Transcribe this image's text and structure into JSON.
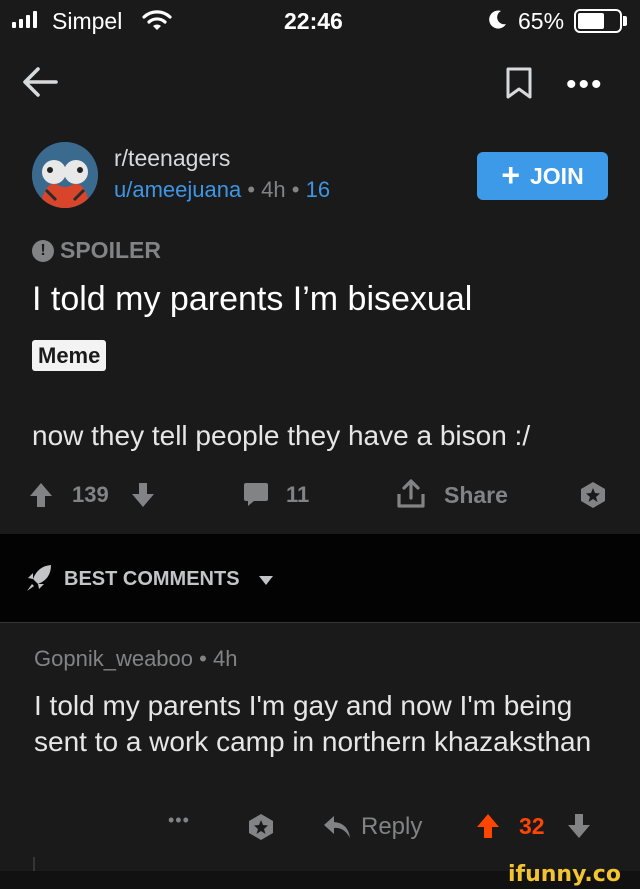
{
  "status_bar": {
    "carrier": "Simpel",
    "time": "22:46",
    "battery": "65%",
    "battery_level": 0.65
  },
  "nav": {
    "back_icon": "arrow-left-icon",
    "save_icon": "bookmark-icon",
    "more_label": "•••"
  },
  "post": {
    "subreddit": "r/teenagers",
    "author": "u/ameejuana",
    "time": "4h",
    "points_meta": "16",
    "separator": "•",
    "join_plus": "+",
    "join_label": "JOIN",
    "spoiler_icon_glyph": "!",
    "spoiler_label": "SPOILER",
    "title": "I told my parents I’m bisexual",
    "flair": "Meme",
    "body": "now they tell people they have a bison :/",
    "votes": "139",
    "comments": "11",
    "share_label": "Share"
  },
  "sort": {
    "label": "BEST COMMENTS"
  },
  "comment": {
    "author": "Gopnik_weaboo",
    "time": "4h",
    "separator": "•",
    "text": "I told my parents I'm gay and now I'm being sent to a work camp in northern khazaksthan",
    "more_label": "•••",
    "reply_label": "Reply",
    "score": "32"
  },
  "watermark": "ifunny.co",
  "colors": {
    "background": "#1a1a1b",
    "accent_blue": "#3d9ae8",
    "upvote_orange": "#ff4500",
    "muted": "#818384"
  }
}
